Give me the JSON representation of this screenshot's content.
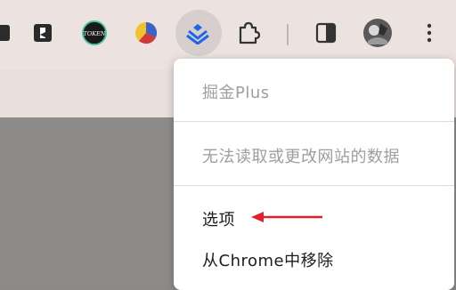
{
  "toolbar": {
    "icons": [
      {
        "name": "partial-extension-icon"
      },
      {
        "name": "bookmark-extension-icon"
      },
      {
        "name": "token-extension-icon",
        "text": "TOKEN"
      },
      {
        "name": "pie-chart-extension-icon"
      },
      {
        "name": "juejin-extension-icon"
      },
      {
        "name": "extensions-puzzle-icon"
      },
      {
        "name": "side-panel-icon"
      },
      {
        "name": "profile-avatar"
      },
      {
        "name": "more-menu-icon"
      }
    ]
  },
  "menu": {
    "title": "掘金Plus",
    "permission_text": "无法读取或更改网站的数据",
    "options_label": "选项",
    "remove_label": "从Chrome中移除"
  },
  "colors": {
    "toolbar_bg": "#ece3e0",
    "page_bg": "#8e8c8b",
    "accent_blue": "#1f66e5",
    "arrow_red": "#e3202a",
    "disabled_text": "#9e9e9e"
  }
}
